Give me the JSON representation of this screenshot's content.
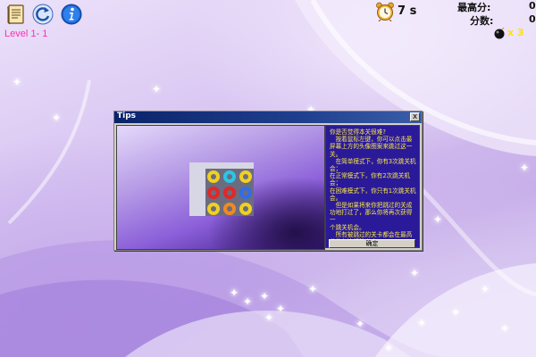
{
  "toolbar": {
    "level_text": "Level 1- 1",
    "timer_text": "7 s",
    "best_score_label": "最高分:",
    "best_score_value": "0",
    "score_label": "分数:",
    "score_value": "0",
    "bomb_count": "x 3",
    "icons": [
      "notes-icon",
      "restart-icon",
      "info-icon",
      "alarm-clock-icon",
      "bomb-icon"
    ]
  },
  "dialog": {
    "title": "Tips",
    "close_label": "x",
    "tip_text": "你是否觉得本关很难?\n　按着鼠标左键，你可以点击最\n屏幕上方的头像图案来跳过这一关。\n　在简单模式下，你有3次跳关机会；\n在正常模式下，你有2次跳关机会；\n在困难模式下，你只有1次跳关机会。\n　但是如果将来你把跳过的关成\n功地打过了，那么你将再次获得一\n个跳关机会。\n　所有被跳过的关卡都会在最高\n分的左边标注出来。",
    "ok_label": "确定"
  },
  "colors": {
    "level_text": "#ff2fb0",
    "tip_text": "#f8e840",
    "tip_panel_bg": "#2a1a9a",
    "titlebar": "#0a246a"
  }
}
